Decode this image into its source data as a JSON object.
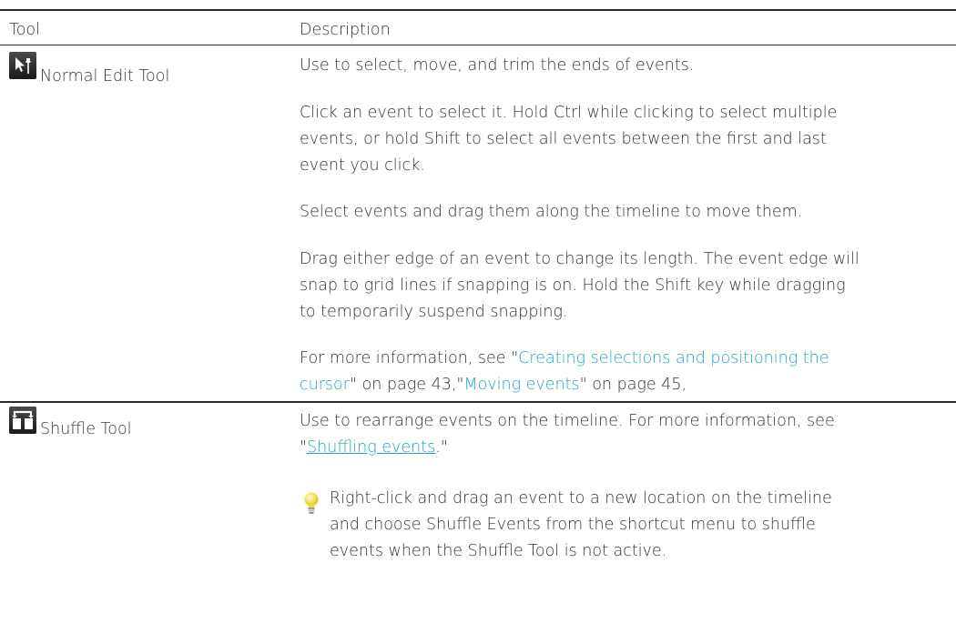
{
  "header": {
    "col_tool": "Tool",
    "col_desc": "Description"
  },
  "rows": [
    {
      "tool_name": "Normal Edit Tool",
      "icon": "normal-edit-tool-icon",
      "p1": "Use to select, move, and trim the ends of events.",
      "p2_lines": [
        "Click an event to select it. Hold Ctrl while clicking to select multiple",
        "events, or hold Shift to select all events between the first and last",
        "event you click."
      ],
      "p3": "Select events and drag them along the timeline to move them.",
      "p4_lines": [
        "Drag either edge of an event to change its length. The event edge will",
        "snap to grid lines if snapping is on. Hold the Shift key while dragging",
        "to temporarily suspend snapping."
      ],
      "more": {
        "prefix": "For more information, see \"",
        "link1_part1": "Creating selections and positioning the",
        "link1_part2": "cursor",
        "mid1": "\" on page 43,\"",
        "link2": "Moving events",
        "mid2": "\" on page 45,"
      }
    },
    {
      "tool_name": "Shuffle Tool",
      "icon": "shuffle-tool-icon",
      "p1_line1": "Use to rearrange events on the timeline. For more information, see",
      "p1_quote_open": "\"",
      "p1_link": "Shuffling events",
      "p1_quote_close": ".\"",
      "tip_lines": [
        "Right-click and drag an event to a new location on the timeline",
        "and choose Shuffle Events from the shortcut menu to shuffle",
        "events when the Shuffle Tool is not active."
      ],
      "tip_icon": "lightbulb-icon"
    }
  ],
  "colors": {
    "link": "#1aa6c8",
    "text": "#333333",
    "rule": "#2a2a2a"
  }
}
